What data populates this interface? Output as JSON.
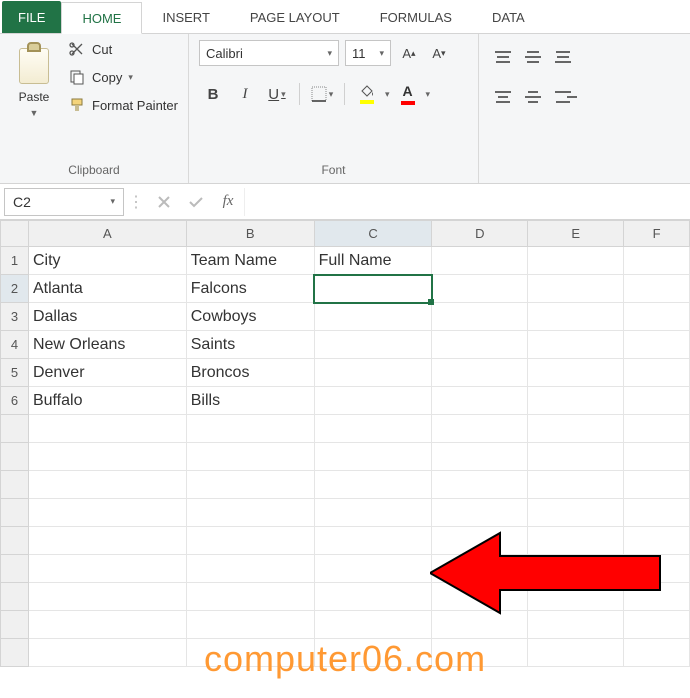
{
  "tabs": {
    "file": "FILE",
    "home": "HOME",
    "insert": "INSERT",
    "pageLayout": "PAGE LAYOUT",
    "formulas": "FORMULAS",
    "data": "DATA"
  },
  "clipboard": {
    "paste": "Paste",
    "cut": "Cut",
    "copy": "Copy",
    "formatPainter": "Format Painter",
    "groupLabel": "Clipboard"
  },
  "font": {
    "name": "Calibri",
    "size": "11",
    "bold": "B",
    "italic": "I",
    "underline": "U",
    "fontColorLetter": "A",
    "groupLabel": "Font"
  },
  "nameBox": "C2",
  "fx": "fx",
  "columns": [
    "A",
    "B",
    "C",
    "D",
    "E",
    "F"
  ],
  "rows": [
    "1",
    "2",
    "3",
    "4",
    "5",
    "6"
  ],
  "chart_data": {
    "type": "table",
    "columns": [
      "City",
      "Team Name",
      "Full Name"
    ],
    "rows": [
      [
        "Atlanta",
        "Falcons",
        ""
      ],
      [
        "Dallas",
        "Cowboys",
        ""
      ],
      [
        "New Orleans",
        "Saints",
        ""
      ],
      [
        "Denver",
        "Broncos",
        ""
      ],
      [
        "Buffalo",
        "Bills",
        ""
      ]
    ]
  },
  "watermark": "computer06.com"
}
